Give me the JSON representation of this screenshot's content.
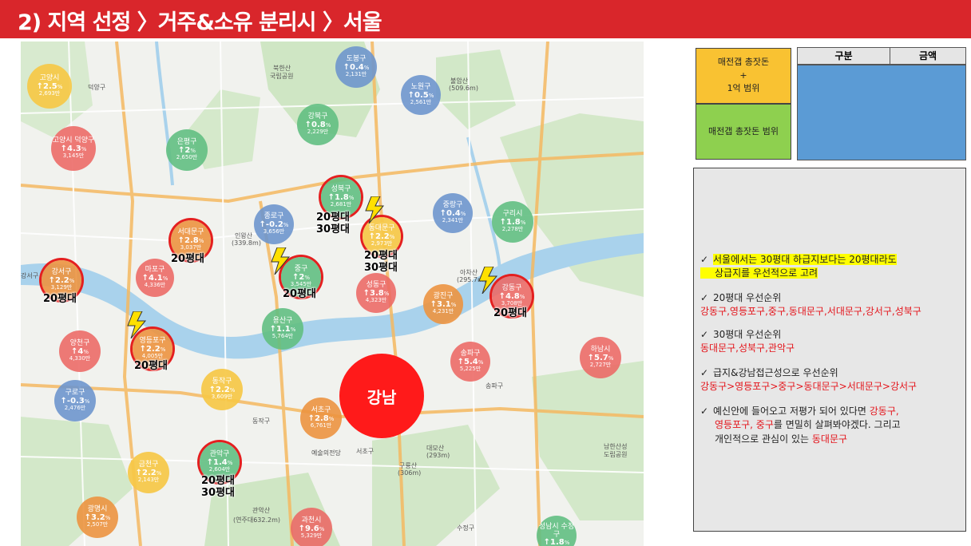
{
  "header": {
    "title": "2) 지역 선정 〉거주&소유 분리시 〉서울"
  },
  "map": {
    "gangnam": "강남",
    "districts": [
      {
        "name": "고양시",
        "change": "2.5",
        "unit": "%",
        "price": "2,693만",
        "color": "yellow"
      },
      {
        "name": "고양시 덕양구",
        "change": "4.3",
        "unit": "%",
        "price": "3,145만",
        "color": "red"
      },
      {
        "name": "은평구",
        "change": "2",
        "unit": "%",
        "price": "2,650만",
        "color": "green"
      },
      {
        "name": "도봉구",
        "change": "0.4",
        "unit": "%",
        "price": "2,131만",
        "color": "blue"
      },
      {
        "name": "노원구",
        "change": "0.5",
        "unit": "%",
        "price": "2,561만",
        "color": "blue"
      },
      {
        "name": "강북구",
        "change": "0.8",
        "unit": "%",
        "price": "2,229만",
        "color": "green"
      },
      {
        "name": "성북구",
        "change": "1.8",
        "unit": "%",
        "price": "2,681만",
        "color": "green"
      },
      {
        "name": "종로구",
        "change": "-0.2",
        "unit": "%",
        "price": "3,656만",
        "color": "blue"
      },
      {
        "name": "서대문구",
        "change": "2.8",
        "unit": "%",
        "price": "3,037만",
        "color": "orange"
      },
      {
        "name": "동대문구",
        "change": "2.2",
        "unit": "%",
        "price": "2,973만",
        "color": "yellow"
      },
      {
        "name": "중랑구",
        "change": "0.4",
        "unit": "%",
        "price": "2,341만",
        "color": "blue"
      },
      {
        "name": "구리시",
        "change": "1.8",
        "unit": "%",
        "price": "2,278만",
        "color": "green"
      },
      {
        "name": "강서구",
        "change": "2.2",
        "unit": "%",
        "price": "3,129만",
        "color": "orange"
      },
      {
        "name": "마포구",
        "change": "4.1",
        "unit": "%",
        "price": "4,336만",
        "color": "red"
      },
      {
        "name": "중구",
        "change": "2",
        "unit": "%",
        "price": "3,545만",
        "color": "green"
      },
      {
        "name": "성동구",
        "change": "3.8",
        "unit": "%",
        "price": "4,323만",
        "color": "red"
      },
      {
        "name": "광진구",
        "change": "3.1",
        "unit": "%",
        "price": "4,231만",
        "color": "orange"
      },
      {
        "name": "강동구",
        "change": "4.8",
        "unit": "%",
        "price": "3,708만",
        "color": "red"
      },
      {
        "name": "용산구",
        "change": "1.1",
        "unit": "%",
        "price": "5,764만",
        "color": "green"
      },
      {
        "name": "양천구",
        "change": "4",
        "unit": "%",
        "price": "4,330만",
        "color": "red"
      },
      {
        "name": "영등포구",
        "change": "2.2",
        "unit": "%",
        "price": "4,005만",
        "color": "orange"
      },
      {
        "name": "동작구",
        "change": "2.2",
        "unit": "%",
        "price": "3,609만",
        "color": "yellow"
      },
      {
        "name": "송파구",
        "change": "5.4",
        "unit": "%",
        "price": "5,225만",
        "color": "red"
      },
      {
        "name": "하남시",
        "change": "5.7",
        "unit": "%",
        "price": "2,727만",
        "color": "red"
      },
      {
        "name": "구로구",
        "change": "-0.3",
        "unit": "%",
        "price": "2,476만",
        "color": "blue"
      },
      {
        "name": "서초구",
        "change": "2.8",
        "unit": "%",
        "price": "6,761만",
        "color": "orange"
      },
      {
        "name": "관악구",
        "change": "1.4",
        "unit": "%",
        "price": "2,604만",
        "color": "green"
      },
      {
        "name": "금천구",
        "change": "2.2",
        "unit": "%",
        "price": "2,143만",
        "color": "yellow"
      },
      {
        "name": "광명시",
        "change": "3.2",
        "unit": "%",
        "price": "2,507만",
        "color": "orange"
      },
      {
        "name": "과천시",
        "change": "9.6",
        "unit": "%",
        "price": "5,329만",
        "color": "red"
      },
      {
        "name": "성남시 수정구",
        "change": "1.8",
        "unit": "%",
        "price": "",
        "color": "green"
      }
    ],
    "tags": {
      "t20": "20평대",
      "t30": "30평대"
    },
    "places": [
      "덕양구",
      "북한산",
      "국립공원",
      "불암산",
      "(509.6m)",
      "인왕산",
      "(339.8m)",
      "아차산",
      "(295.7m)",
      "예술의전당",
      "관악산",
      "(연주대632.2m)",
      "구룡산",
      "(306m)",
      "대모산",
      "(293m)",
      "남한산성",
      "도립공원",
      "서초구",
      "송파구",
      "수정구",
      "강서구",
      "동작구"
    ]
  },
  "legend": {
    "yellow_label": "매전갭 총잣돈\n+\n1억 범위",
    "green_label": "매전갭 총잣돈 범위",
    "col_category": "구분",
    "col_amount": "금액",
    "yellow_color": "#f9c232",
    "green_color": "#8ed04f",
    "blue_color": "#5b9bd5"
  },
  "notes": {
    "n1_line1": "서울에서는 30평대 하급지보다는 20평대라도",
    "n1_line2": "상급지를 우선적으로 고려",
    "n2_title": "20평대 우선순위",
    "n2_list": "강동구,영등포구,중구,동대문구,서대문구,강서구,성북구",
    "n3_title": "30평대 우선순위",
    "n3_list": "동대문구,성북구,관악구",
    "n4_title": "급지&강남접근성으로  우선순위",
    "n4_list": "강동구>영등포구>중구>동대문구>서대문구>강서구",
    "n5_a": "예신안에 들어오고 저평가 되어 있다면",
    "n5_b": "강동구,",
    "n5_c": "영등포구, 중구",
    "n5_d": "를 면밀히 살펴봐야겠다.  그리고",
    "n5_e": "개인적으로 관심이 있는",
    "n5_f": "동대문구",
    "check": "✓"
  }
}
